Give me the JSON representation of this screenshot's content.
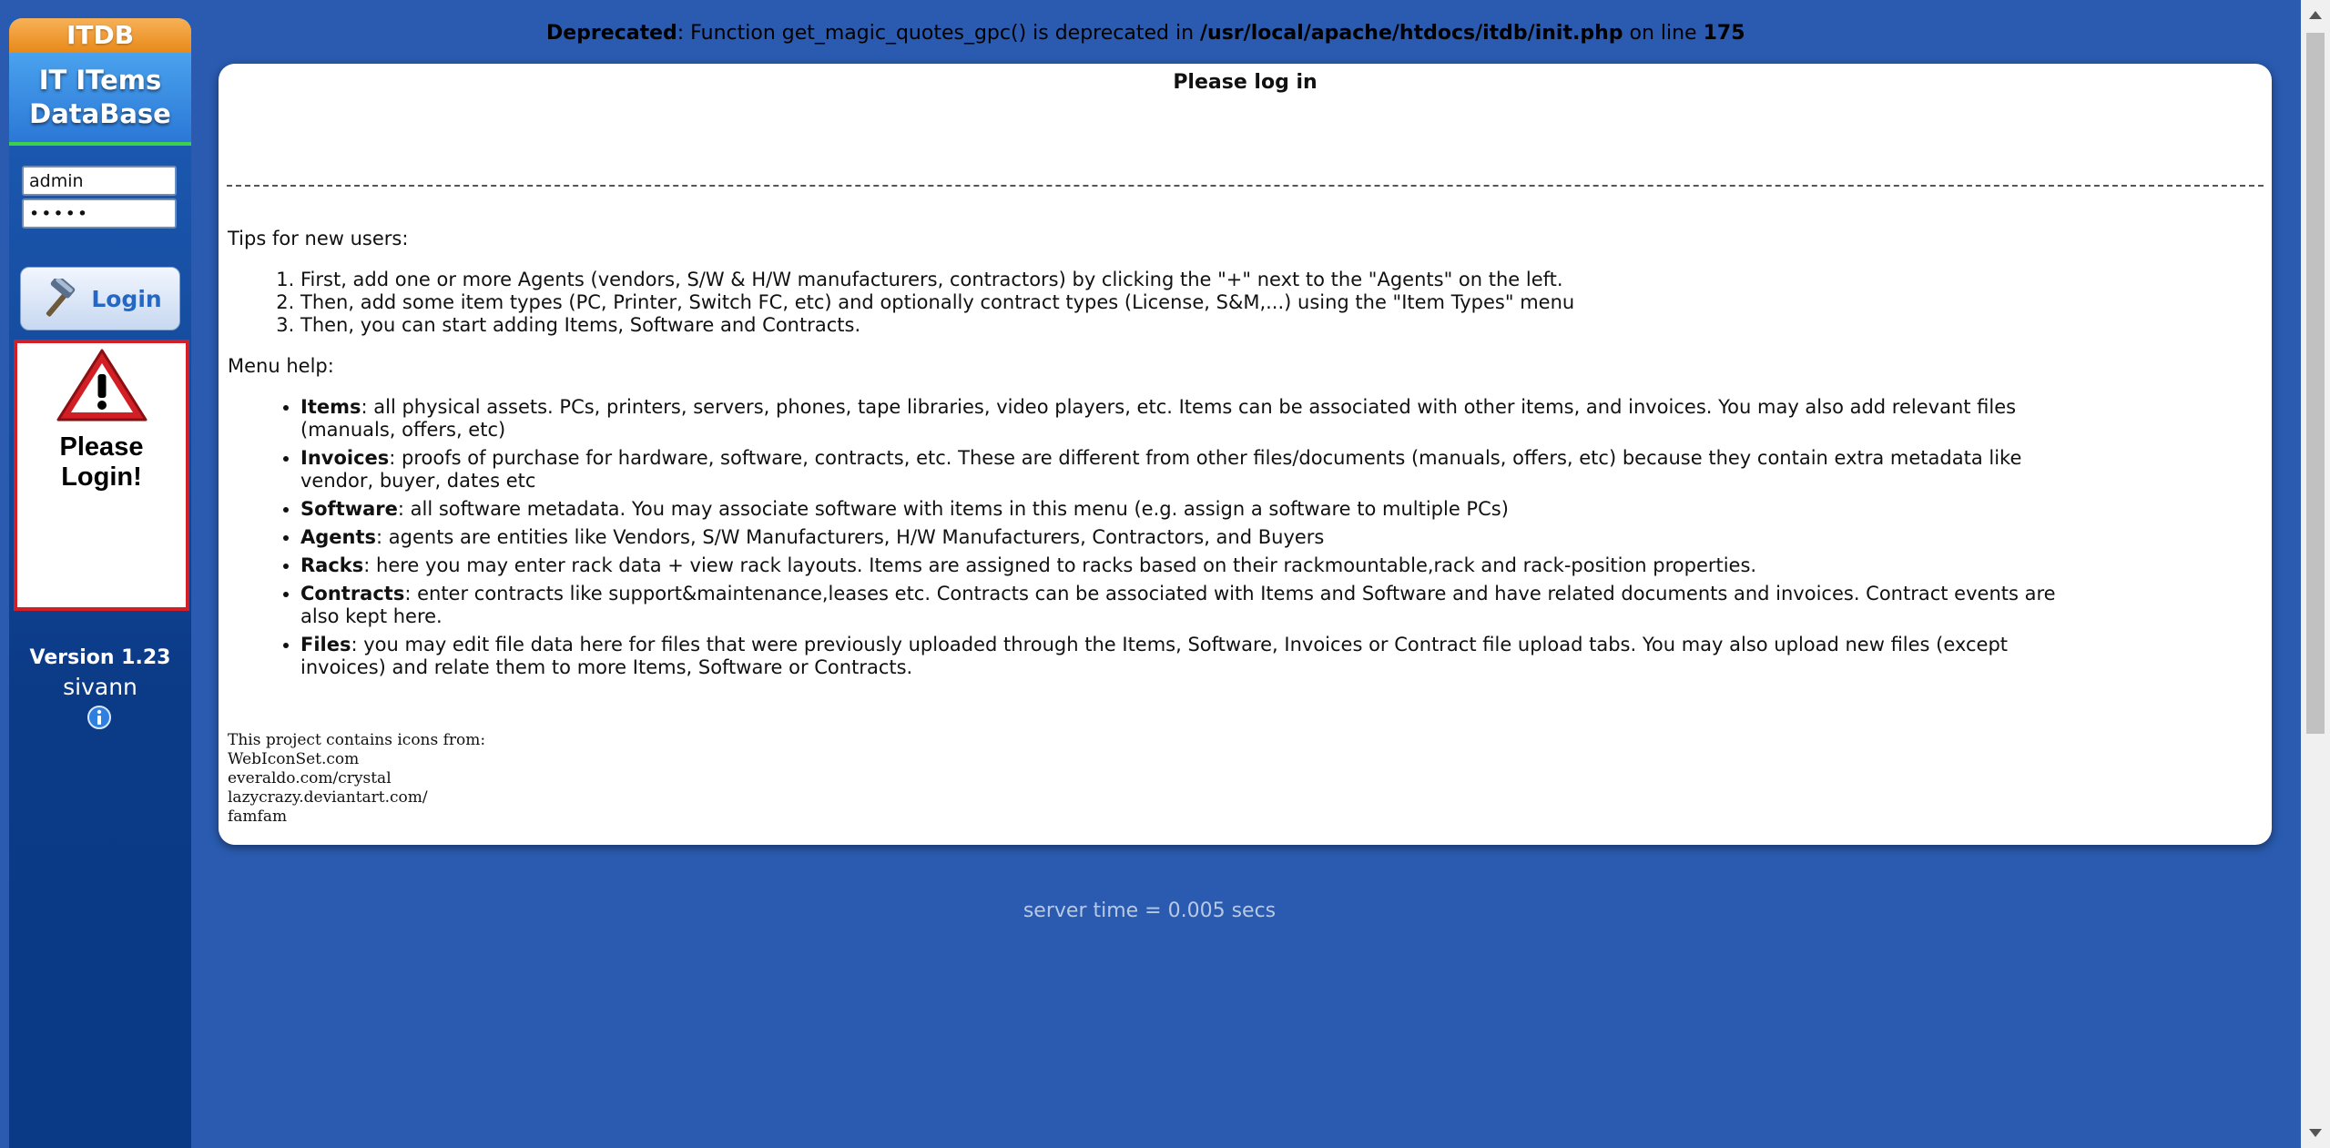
{
  "app": {
    "brand_tab": "ITDB",
    "brand_line1": "IT ITems",
    "brand_line2": "DataBase",
    "version": "Version 1.23",
    "author": "sivann"
  },
  "login": {
    "username_value": "admin",
    "password_value": "•••••",
    "button_label": "Login",
    "warning_line1": "Please",
    "warning_line2": "Login!"
  },
  "deprecated": {
    "label": "Deprecated",
    "text1": ": Function get_magic_quotes_gpc() is deprecated in ",
    "path": "/usr/local/apache/htdocs/itdb/init.php",
    "text2": " on line ",
    "line": "175"
  },
  "main": {
    "title": "Please log in",
    "tips_heading": "Tips for new users:",
    "tips": [
      "First, add one or more Agents (vendors, S/W & H/W manufacturers, contractors) by clicking the \"+\" next to the \"Agents\" on the left.",
      "Then, add some item types (PC, Printer, Switch FC, etc) and optionally contract types (License, S&M,...) using the \"Item Types\" menu",
      "Then, you can start adding Items, Software and Contracts."
    ],
    "menu_heading": "Menu help:",
    "menu": [
      {
        "term": "Items",
        "desc": ": all physical assets. PCs, printers, servers, phones, tape libraries, video players, etc. Items can be associated with other items, and invoices. You may also add relevant files (manuals, offers, etc)"
      },
      {
        "term": "Invoices",
        "desc": ": proofs of purchase for hardware, software, contracts, etc. These are different from other files/documents (manuals, offers, etc) because they contain extra metadata like vendor, buyer, dates etc"
      },
      {
        "term": "Software",
        "desc": ": all software metadata. You may associate software with items in this menu (e.g. assign a software to multiple PCs)"
      },
      {
        "term": "Agents",
        "desc": ": agents are entities like Vendors, S/W Manufacturers, H/W Manufacturers, Contractors, and Buyers"
      },
      {
        "term": "Racks",
        "desc": ": here you may enter rack data + view rack layouts. Items are assigned to racks based on their rackmountable,rack and rack-position properties."
      },
      {
        "term": "Contracts",
        "desc": ": enter contracts like support&maintenance,leases etc. Contracts can be associated with Items and Software and have related documents and invoices. Contract events are also kept here."
      },
      {
        "term": "Files",
        "desc": ": you may edit file data here for files that were previously uploaded through the Items, Software, Invoices or Contract file upload tabs. You may also upload new files (except invoices) and relate them to more Items, Software or Contracts."
      }
    ],
    "credits": [
      "This project contains icons from:",
      "WebIconSet.com",
      "everaldo.com/crystal",
      "lazycrazy.deviantart.com/",
      "famfam"
    ]
  },
  "footer": {
    "server_time": "server time = 0.005 secs"
  },
  "colors": {
    "page_bg": "#2a5bb0",
    "brand_orange": "#f0a23a",
    "warning_red": "#d21f26",
    "login_text": "#2568c4"
  },
  "icons": [
    "hammer-icon",
    "warning-icon",
    "info-icon"
  ]
}
